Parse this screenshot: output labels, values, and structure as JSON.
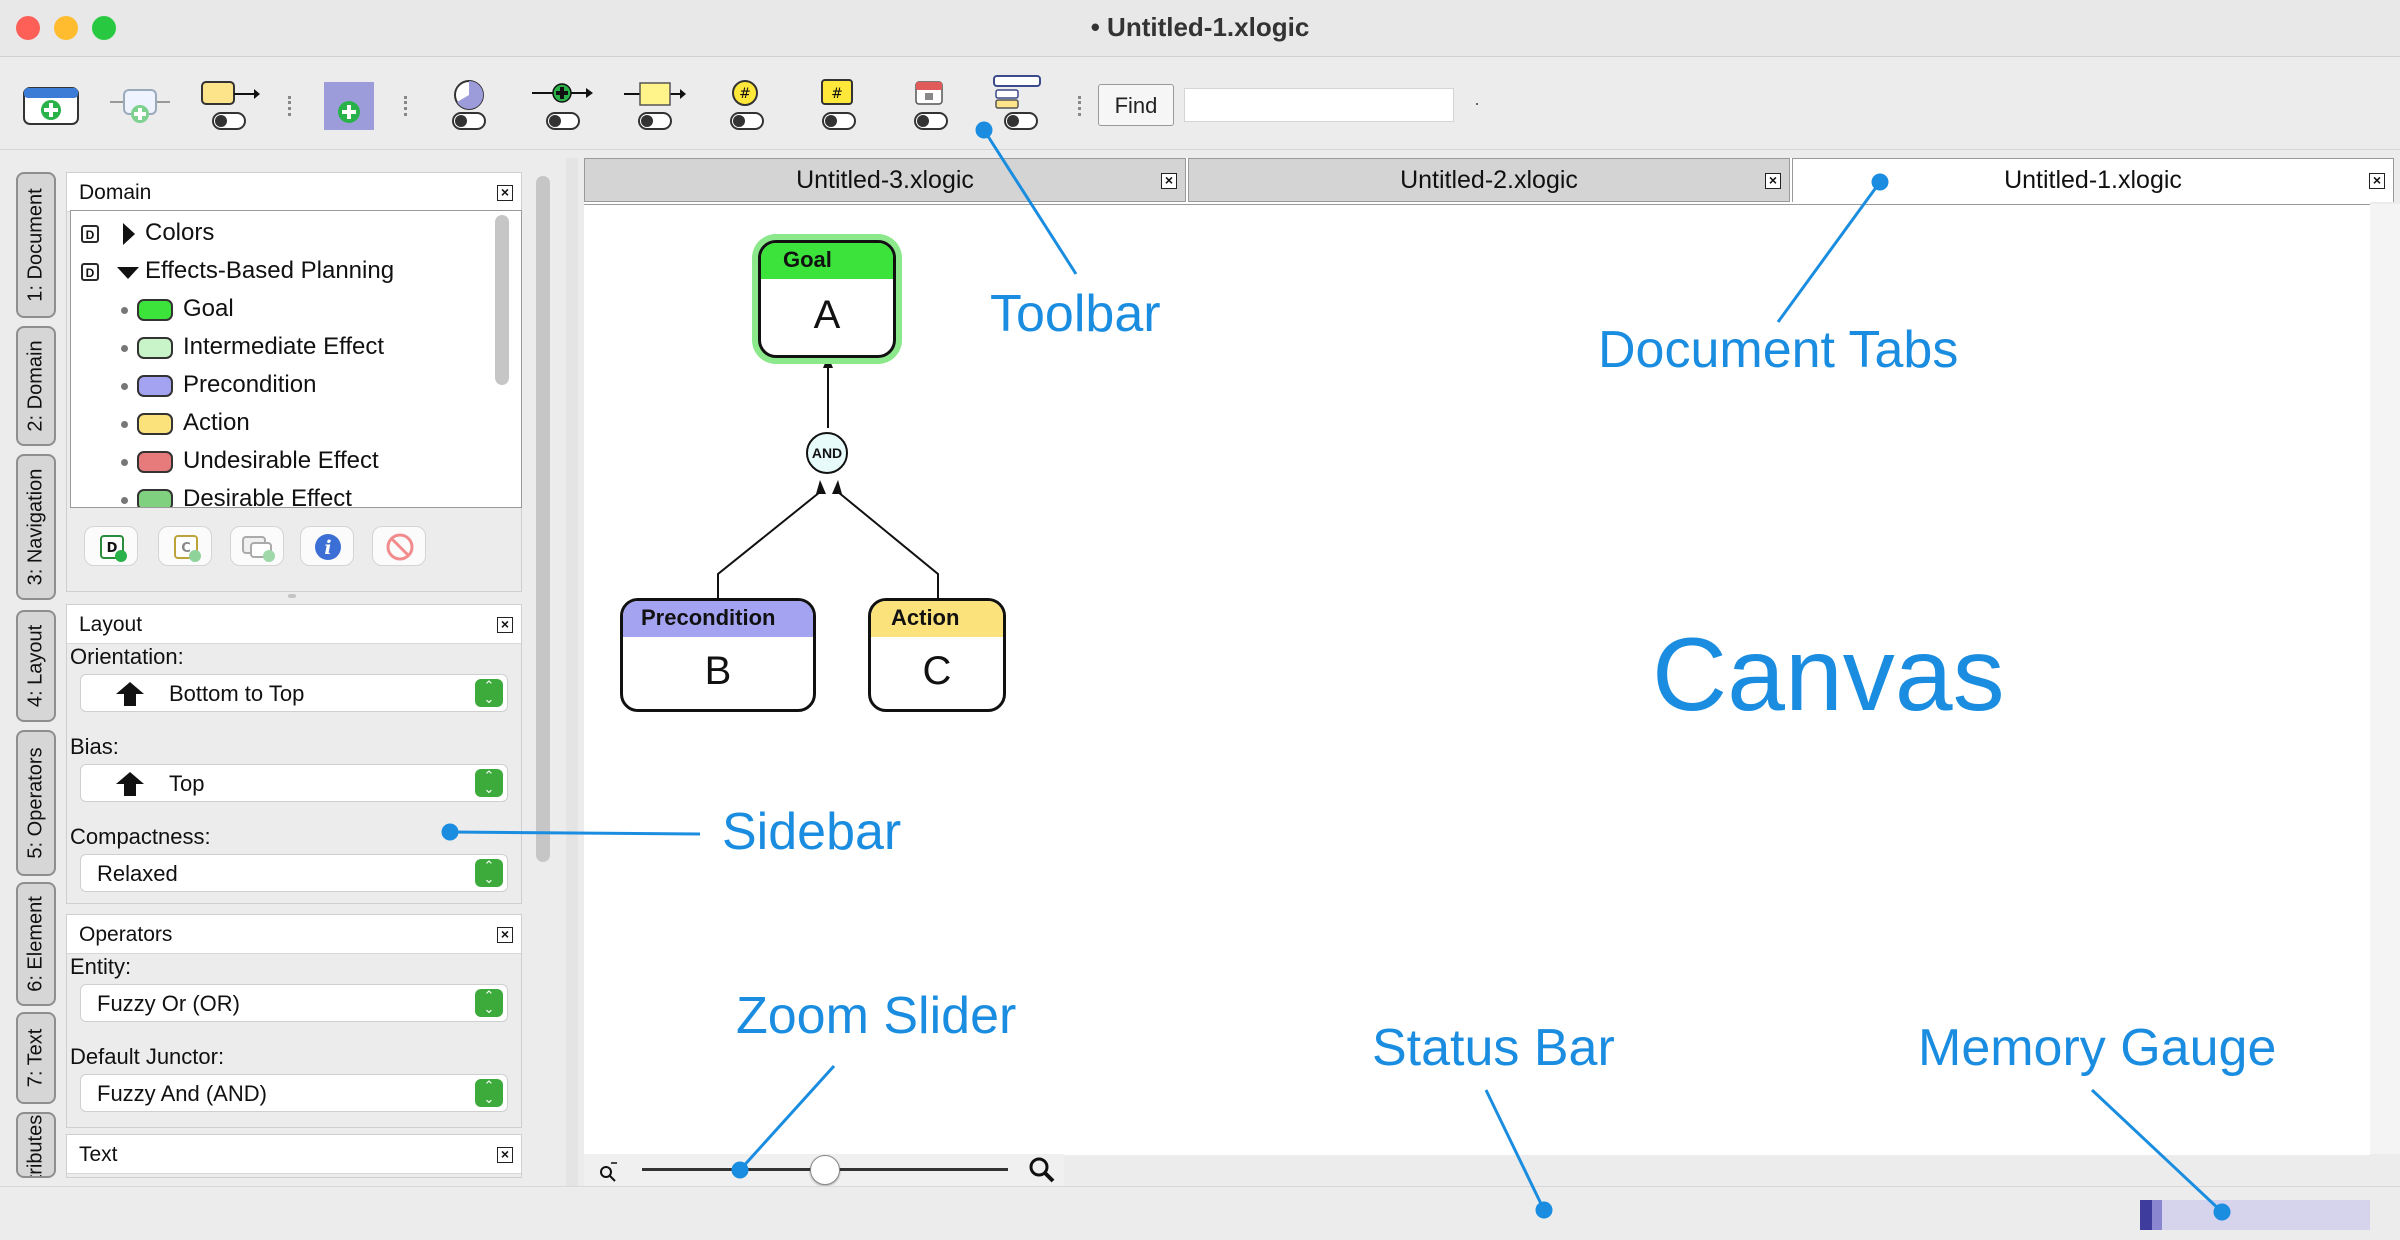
{
  "window": {
    "title": "• Untitled-1.xlogic"
  },
  "toolbar": {
    "find_label": "Find",
    "find_value": ""
  },
  "sidebar": {
    "tabs": [
      "1: Document",
      "2: Domain",
      "3: Navigation",
      "4: Layout",
      "5: Operators",
      "6: Element",
      "7: Text",
      "Attributes"
    ],
    "domain_panel": {
      "title": "Domain",
      "items": [
        {
          "label": "Colors",
          "badge": "D",
          "kind": "collapsed"
        },
        {
          "label": "Effects-Based Planning",
          "badge": "D",
          "kind": "expanded"
        },
        {
          "label": "Goal",
          "color": "#3be33b"
        },
        {
          "label": "Intermediate Effect",
          "color": "#c9f4c9"
        },
        {
          "label": "Precondition",
          "color": "#a3a3f2"
        },
        {
          "label": "Action",
          "color": "#fbe27a"
        },
        {
          "label": "Undesirable Effect",
          "color": "#e77a7a"
        },
        {
          "label": "Desirable Effect",
          "color": "#7fd07f"
        }
      ]
    },
    "layout_panel": {
      "title": "Layout",
      "orientation_label": "Orientation:",
      "orientation_value": "Bottom to Top",
      "bias_label": "Bias:",
      "bias_value": "Top",
      "compactness_label": "Compactness:",
      "compactness_value": "Relaxed"
    },
    "operators_panel": {
      "title": "Operators",
      "entity_label": "Entity:",
      "entity_value": "Fuzzy Or (OR)",
      "junctor_label": "Default Junctor:",
      "junctor_value": "Fuzzy And (AND)"
    },
    "text_panel": {
      "title": "Text"
    }
  },
  "document_tabs": [
    "Untitled-3.xlogic",
    "Untitled-2.xlogic",
    "Untitled-1.xlogic"
  ],
  "canvas": {
    "nodes": [
      {
        "header": "Goal",
        "body": "A",
        "color": "#3be33b"
      },
      {
        "header": "Precondition",
        "body": "B",
        "color": "#a3a3f2"
      },
      {
        "header": "Action",
        "body": "C",
        "color": "#fbe27a"
      }
    ],
    "junctor": "AND"
  },
  "annotations": {
    "toolbar": "Toolbar",
    "document_tabs": "Document Tabs",
    "canvas": "Canvas",
    "sidebar": "Sidebar",
    "zoom_slider": "Zoom Slider",
    "status_bar": "Status Bar",
    "memory_gauge": "Memory Gauge"
  },
  "colors": {
    "accent": "#1a8de0"
  }
}
